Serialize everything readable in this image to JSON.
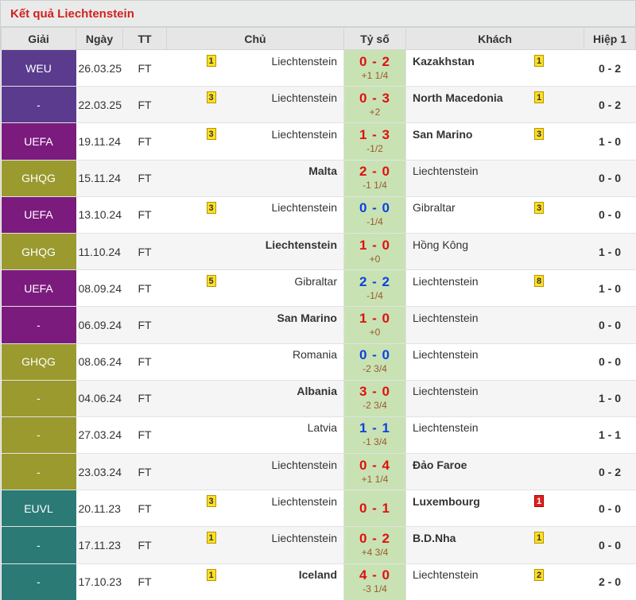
{
  "title": "Kết quả Liechtenstein",
  "headers": {
    "league": "Giải",
    "date": "Ngày",
    "status": "TT",
    "home": "Chủ",
    "score": "Tỷ số",
    "away": "Khách",
    "half": "Hiệp 1"
  },
  "league_colors": {
    "WEU": "#5b3a8c",
    "-": "#5b3a8c",
    "UEFA": "#7a1a7a",
    "GHQG": "#9a9a2a",
    "EUVL": "#2a7a7a"
  },
  "rows": [
    {
      "league": "WEU",
      "color": "#5a3b8e",
      "date": "26.03.25",
      "status": "FT",
      "home": "Liechtenstein",
      "home_bold": false,
      "home_card": "1",
      "home_card_color": "yellow",
      "score": "0 - 2",
      "score_type": "loss",
      "handicap": "+1 1/4",
      "away": "Kazakhstan",
      "away_bold": true,
      "away_card": "1",
      "away_card_color": "yellow",
      "half": "0 - 2"
    },
    {
      "league": "-",
      "color": "#5a3b8e",
      "date": "22.03.25",
      "status": "FT",
      "home": "Liechtenstein",
      "home_bold": false,
      "home_card": "3",
      "home_card_color": "yellow",
      "score": "0 - 3",
      "score_type": "loss",
      "handicap": "+2",
      "away": "North Macedonia",
      "away_bold": true,
      "away_card": "1",
      "away_card_color": "yellow",
      "half": "0 - 2"
    },
    {
      "league": "UEFA",
      "color": "#7b1b7e",
      "date": "19.11.24",
      "status": "FT",
      "home": "Liechtenstein",
      "home_bold": false,
      "home_card": "3",
      "home_card_color": "yellow",
      "score": "1 - 3",
      "score_type": "loss",
      "handicap": "-1/2",
      "away": "San Marino",
      "away_bold": true,
      "away_card": "3",
      "away_card_color": "yellow",
      "half": "1 - 0"
    },
    {
      "league": "GHQG",
      "color": "#9a9a2e",
      "date": "15.11.24",
      "status": "FT",
      "home": "Malta",
      "home_bold": true,
      "home_card": "",
      "home_card_color": "",
      "score": "2 - 0",
      "score_type": "win",
      "handicap": "-1 1/4",
      "away": "Liechtenstein",
      "away_bold": false,
      "away_card": "",
      "away_card_color": "",
      "half": "0 - 0"
    },
    {
      "league": "UEFA",
      "color": "#7b1b7e",
      "date": "13.10.24",
      "status": "FT",
      "home": "Liechtenstein",
      "home_bold": false,
      "home_card": "3",
      "home_card_color": "yellow",
      "score": "0 - 0",
      "score_type": "draw",
      "handicap": "-1/4",
      "away": "Gibraltar",
      "away_bold": false,
      "away_card": "3",
      "away_card_color": "yellow",
      "half": "0 - 0"
    },
    {
      "league": "GHQG",
      "color": "#9a9a2e",
      "date": "11.10.24",
      "status": "FT",
      "home": "Liechtenstein",
      "home_bold": true,
      "home_card": "",
      "home_card_color": "",
      "score": "1 - 0",
      "score_type": "win",
      "handicap": "+0",
      "away": "Hồng Kông",
      "away_bold": false,
      "away_card": "",
      "away_card_color": "",
      "half": "1 - 0"
    },
    {
      "league": "UEFA",
      "color": "#7b1b7e",
      "date": "08.09.24",
      "status": "FT",
      "home": "Gibraltar",
      "home_bold": false,
      "home_card": "5",
      "home_card_color": "yellow",
      "score": "2 - 2",
      "score_type": "draw",
      "handicap": "-1/4",
      "away": "Liechtenstein",
      "away_bold": false,
      "away_card": "8",
      "away_card_color": "yellow",
      "half": "1 - 0"
    },
    {
      "league": "-",
      "color": "#7b1b7e",
      "date": "06.09.24",
      "status": "FT",
      "home": "San Marino",
      "home_bold": true,
      "home_card": "",
      "home_card_color": "",
      "score": "1 - 0",
      "score_type": "win",
      "handicap": "+0",
      "away": "Liechtenstein",
      "away_bold": false,
      "away_card": "",
      "away_card_color": "",
      "half": "0 - 0"
    },
    {
      "league": "GHQG",
      "color": "#9a9a2e",
      "date": "08.06.24",
      "status": "FT",
      "home": "Romania",
      "home_bold": false,
      "home_card": "",
      "home_card_color": "",
      "score": "0 - 0",
      "score_type": "draw",
      "handicap": "-2 3/4",
      "away": "Liechtenstein",
      "away_bold": false,
      "away_card": "",
      "away_card_color": "",
      "half": "0 - 0"
    },
    {
      "league": "-",
      "color": "#9a9a2e",
      "date": "04.06.24",
      "status": "FT",
      "home": "Albania",
      "home_bold": true,
      "home_card": "",
      "home_card_color": "",
      "score": "3 - 0",
      "score_type": "win",
      "handicap": "-2 3/4",
      "away": "Liechtenstein",
      "away_bold": false,
      "away_card": "",
      "away_card_color": "",
      "half": "1 - 0"
    },
    {
      "league": "-",
      "color": "#9a9a2e",
      "date": "27.03.24",
      "status": "FT",
      "home": "Latvia",
      "home_bold": false,
      "home_card": "",
      "home_card_color": "",
      "score": "1 - 1",
      "score_type": "draw",
      "handicap": "-1 3/4",
      "away": "Liechtenstein",
      "away_bold": false,
      "away_card": "",
      "away_card_color": "",
      "half": "1 - 1"
    },
    {
      "league": "-",
      "color": "#9a9a2e",
      "date": "23.03.24",
      "status": "FT",
      "home": "Liechtenstein",
      "home_bold": false,
      "home_card": "",
      "home_card_color": "",
      "score": "0 - 4",
      "score_type": "loss",
      "handicap": "+1 1/4",
      "away": "Đảo Faroe",
      "away_bold": true,
      "away_card": "",
      "away_card_color": "",
      "half": "0 - 2"
    },
    {
      "league": "EUVL",
      "color": "#2b7a76",
      "date": "20.11.23",
      "status": "FT",
      "home": "Liechtenstein",
      "home_bold": false,
      "home_card": "3",
      "home_card_color": "yellow",
      "score": "0 - 1",
      "score_type": "loss",
      "handicap": "",
      "away": "Luxembourg",
      "away_bold": true,
      "away_card": "1",
      "away_card_color": "red",
      "half": "0 - 0"
    },
    {
      "league": "-",
      "color": "#2b7a76",
      "date": "17.11.23",
      "status": "FT",
      "home": "Liechtenstein",
      "home_bold": false,
      "home_card": "1",
      "home_card_color": "yellow",
      "score": "0 - 2",
      "score_type": "loss",
      "handicap": "+4 3/4",
      "away": "B.D.Nha",
      "away_bold": true,
      "away_card": "1",
      "away_card_color": "yellow",
      "half": "0 - 0"
    },
    {
      "league": "-",
      "color": "#2b7a76",
      "date": "17.10.23",
      "status": "FT",
      "home": "Iceland",
      "home_bold": true,
      "home_card": "1",
      "home_card_color": "yellow",
      "score": "4 - 0",
      "score_type": "win",
      "handicap": "-3 1/4",
      "away": "Liechtenstein",
      "away_bold": false,
      "away_card": "2",
      "away_card_color": "yellow",
      "half": "2 - 0"
    }
  ]
}
